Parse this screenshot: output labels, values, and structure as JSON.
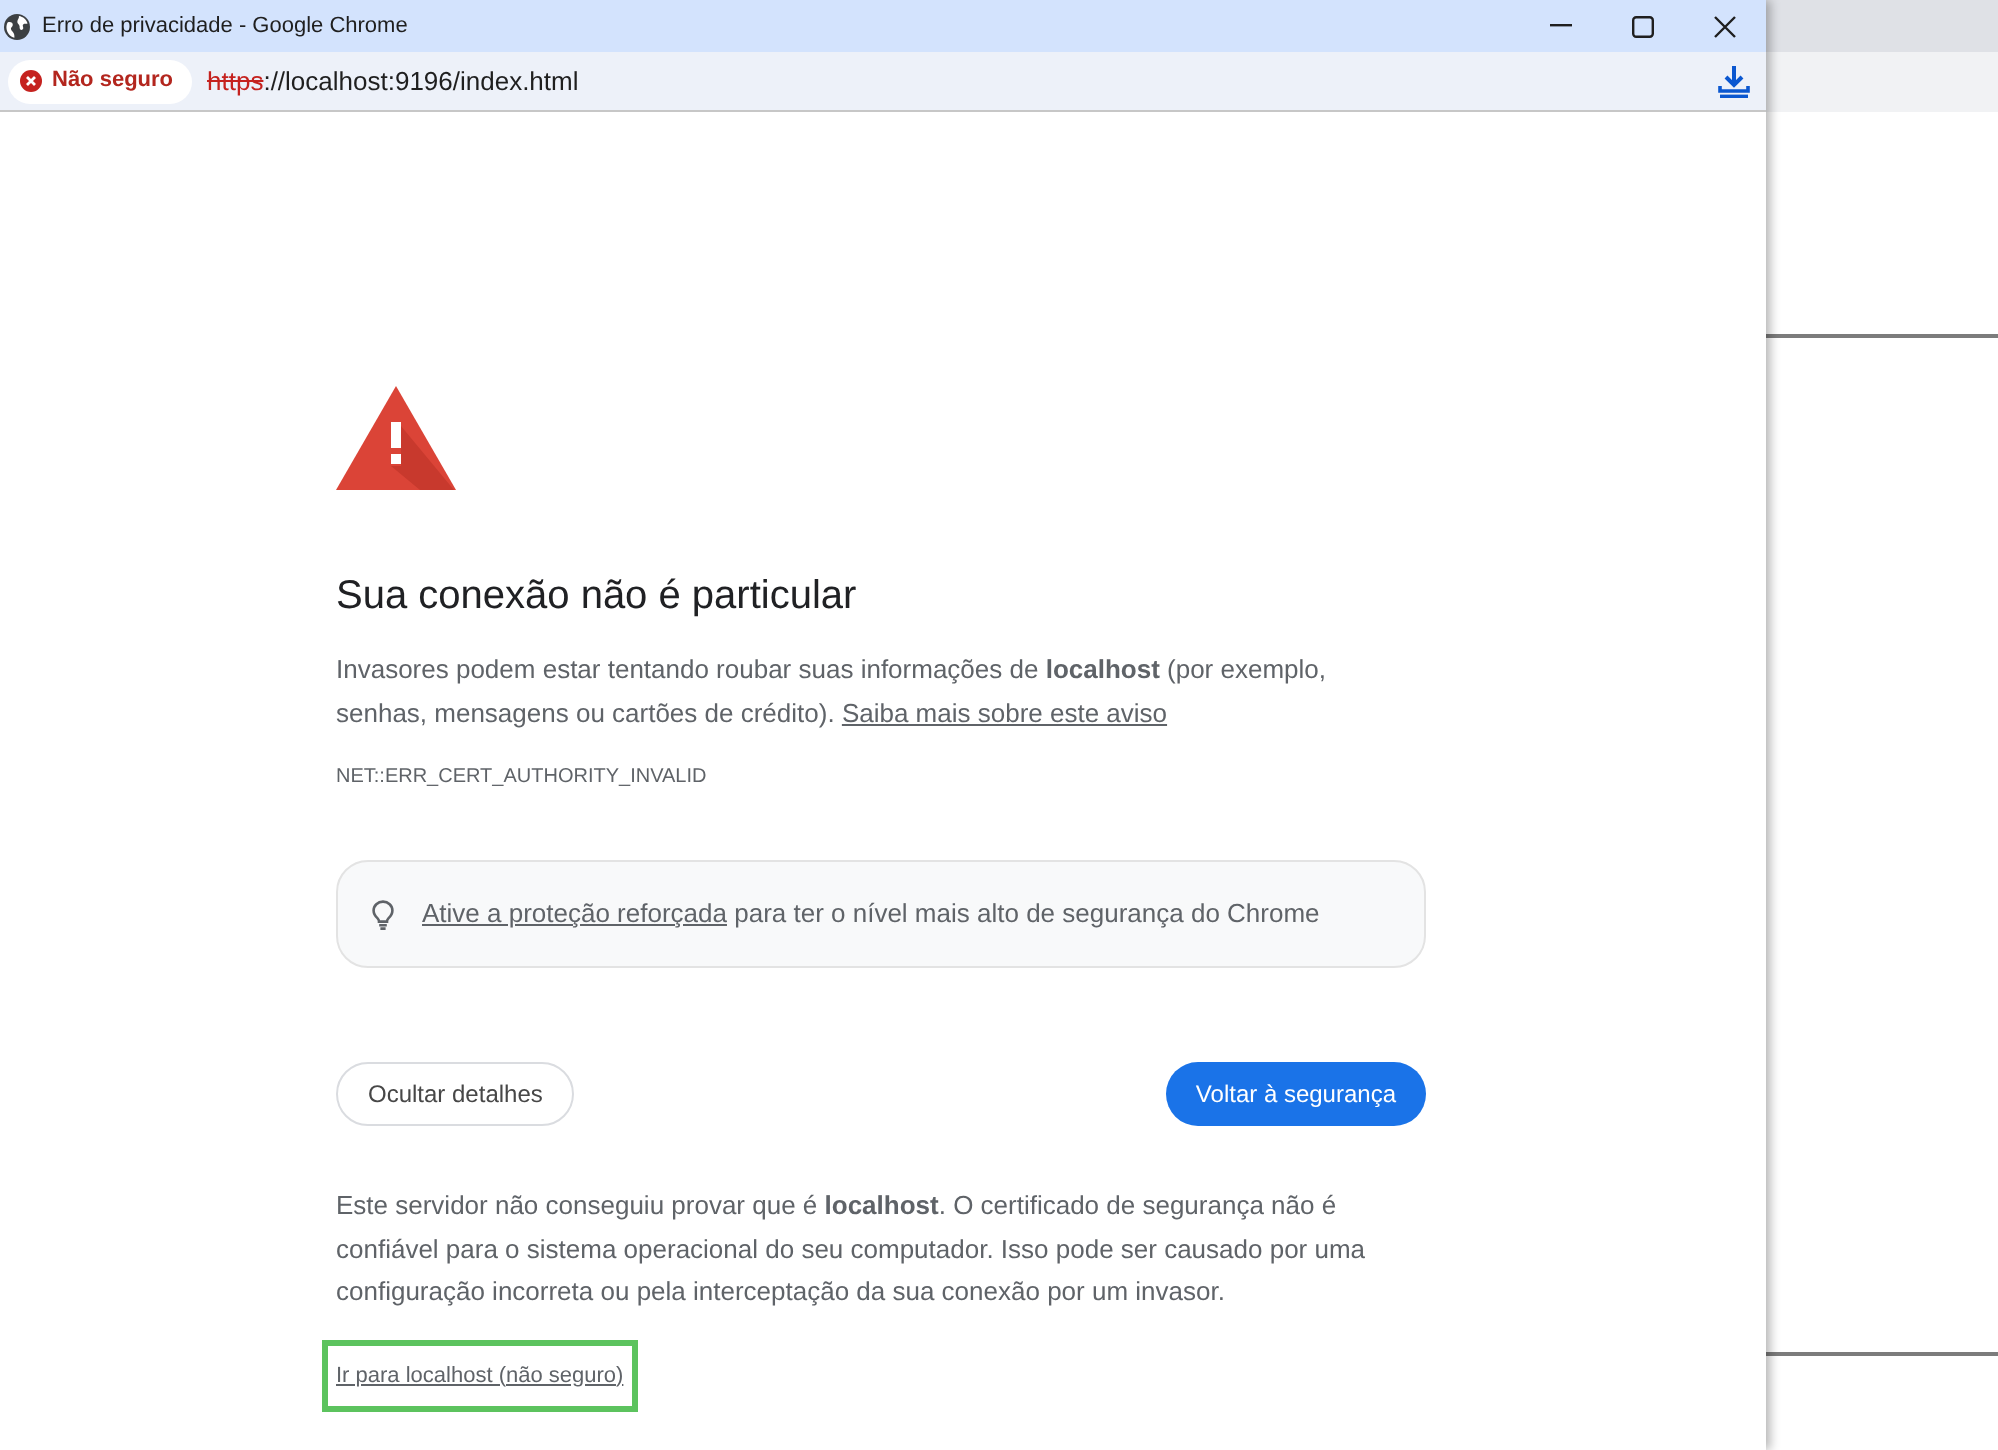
{
  "window": {
    "title": "Erro de privacidade - Google Chrome"
  },
  "address_bar": {
    "security_chip": "Não seguro",
    "url_scheme": "https",
    "url_rest": "://localhost:9196/index.html",
    "scheme_struck": true
  },
  "interstitial": {
    "heading": "Sua conexão não é particular",
    "intro": "Invasores podem estar tentando roubar suas informações de **localhost** (por exemplo, senhas, mensagens ou cartões de crédito).",
    "learn_more_link": "Saiba mais sobre este aviso",
    "error_code": "NET::ERR_CERT_AUTHORITY_INVALID",
    "promo": {
      "link": "Ative a proteção reforçada",
      "text": "para ter o nível mais alto de segurança do Chrome"
    },
    "buttons": [
      {
        "label": "Ocultar detalhes",
        "kind": "secondary"
      },
      {
        "label": "Voltar à segurança",
        "kind": "primary"
      }
    ],
    "details": "Este servidor não conseguiu provar que é **localhost**. O certificado de segurança não é confiável para o sistema operacional do seu computador. Isso pode ser causado por uma configuração incorreta ou pela interceptação da sua conexão por um invasor.",
    "proceed_link": {
      "label": "Ir para localhost (não seguro)",
      "highlighted": true
    }
  }
}
